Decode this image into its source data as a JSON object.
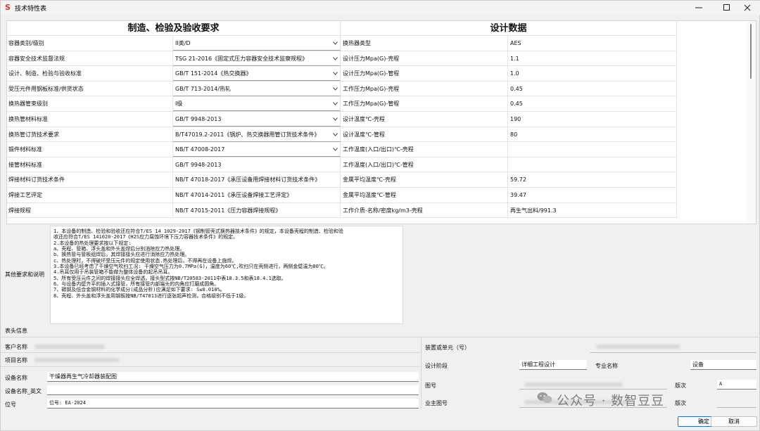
{
  "window": {
    "title": "技术特性表",
    "app_icon": "S"
  },
  "grid": {
    "header_left": "制造、检验及验收要求",
    "header_right": "设计数据",
    "rows": [
      {
        "label": "容器类别/级别",
        "value": "II类/D",
        "dropdown": true,
        "design_label": "换热器类型",
        "design_value": "AES"
      },
      {
        "label": "容器安全技术监督法规",
        "value": "TSG 21-2016《固定式压力容器安全技术监察规程》",
        "dropdown": true,
        "design_label": "设计压力Mpa(G)-壳程",
        "design_value": "1.1"
      },
      {
        "label": "设计、制造、检验与验收标准",
        "value": "GB/T 151-2014《热交换器》",
        "dropdown": true,
        "design_label": "设计压力Mpa(G)-管程",
        "design_value": "1.0"
      },
      {
        "label": "受压元件用钢板标准/供货状态",
        "value": "GB/T 713-2014/热轧",
        "dropdown": true,
        "design_label": "工作压力Mpa(G)-壳程",
        "design_value": "0.45"
      },
      {
        "label": "换热器管束级别",
        "value": "I级",
        "dropdown": true,
        "design_label": "工作压力Mpa(G)-管程",
        "design_value": "0.45"
      },
      {
        "label": "换热管材料标准",
        "value": "GB/T 9948-2013",
        "dropdown": true,
        "design_label": "设计温度℃-壳程",
        "design_value": "190"
      },
      {
        "label": "换热管订货技术要求",
        "value": "B/T47019.2-2011《锅炉、热交换器用管订货技术条件》",
        "dropdown": true,
        "design_label": "设计温度℃-管程",
        "design_value": "80"
      },
      {
        "label": "锻件材料标准",
        "value": "NB/T 47008-2017",
        "dropdown": true,
        "design_label": "工作温度(入口/出口)℃-壳程",
        "design_value": ""
      },
      {
        "label": "接管材料标准",
        "value": "GB/T 9948-2013",
        "dropdown": false,
        "design_label": "工作温度(入口/出口)℃-管程",
        "design_value": ""
      },
      {
        "label": "焊接材料订货技术条件",
        "value": "NB/T 47018-2017《承压设备用焊接材料订货技术条件》",
        "dropdown": false,
        "design_label": "金属平均温度℃-壳程",
        "design_value": "59.72"
      },
      {
        "label": "焊接工艺评定",
        "value": "NB/T 47014-2011《承压设备焊接工艺评定》",
        "dropdown": false,
        "design_label": "金属平均温度℃-管程",
        "design_value": "39.47"
      },
      {
        "label": "焊接规程",
        "value": "NB/T 47015-2011《压力容器焊接规程》",
        "dropdown": false,
        "design_label": "工作介质-名称/密度kg/m3-壳程",
        "design_value": "再生气出料/991.3"
      }
    ]
  },
  "notes": {
    "label": "其他要求和说明",
    "lines": [
      "1、本设备的制造、检验和验收还应符合T/ES 14 1029-2017《钢制管壳式换热器技术条件》的规定，本设备壳程的制造、检验和验",
      "收还应符合T/ES 141020-2017《H2S应力腐蚀环境下压力容器技术条件》的规定。",
      "2.本设备的热处理要求按以下规定:",
      "a、壳程、管箱、浮头盖和外头盖焊后分别消除应力热处理。",
      "b、换热管与管板组焊后，其焊接接头应进行消除应力热处理。",
      "c、热处理时，不得破坏受压元件的规定使用状态.热处理后，不得再在设备上施焊。",
      "3.本设备已经考虑了干燥空气吹扫工况: 干燥空气压力为0.7MPa(G)，温度为60℃,吹扫只在壳侧进行，两侧金壁温为80℃。",
      "4.吊耳仅用于吊装管箱不能做为整体设备的起吊吊耳。",
      "5、所有受压元件之间的焊接接头应全焊透，接头型式按NB/T20583-2011中表18.3.5和表18.4.1选取。",
      "6、与设备内壁齐平的插入式接管，所有接管内部端头的内角应打磨成圆角。",
      "7、碳钢及低合金钢材料的化学成分(成品分析)应满足如下要求: S≤0.010%。",
      "8、壳程、外头盖和浮头盖用钢板按NB/T47013进行逐张超声检测，合格级别不低于I级。"
    ]
  },
  "header_info": {
    "section_label": "表头信息",
    "customer_label": "客户名称",
    "project_label": "项目名称",
    "device_name_label": "设备名称",
    "device_name_value": "干燥器再生气冷却器装配图",
    "device_name_en_label": "设备名称_英文",
    "device_name_en_value": "",
    "position_label": "位号",
    "position_value": "位号: EA-2024",
    "unit_label": "装置或单元（号）",
    "design_stage_label": "设计阶段",
    "design_stage_value": "详细工程设计",
    "specialty_label": "专业名称",
    "specialty_value": "设备",
    "drawing_no_label": "图号",
    "revision_label": "版次",
    "revision_value": "A",
    "owner_drawing_label": "业主图号",
    "revision2_label": "版次"
  },
  "watermark": {
    "text": "公众号 · 数智豆豆"
  },
  "buttons": {
    "ok": "确定",
    "cancel": "取消"
  }
}
